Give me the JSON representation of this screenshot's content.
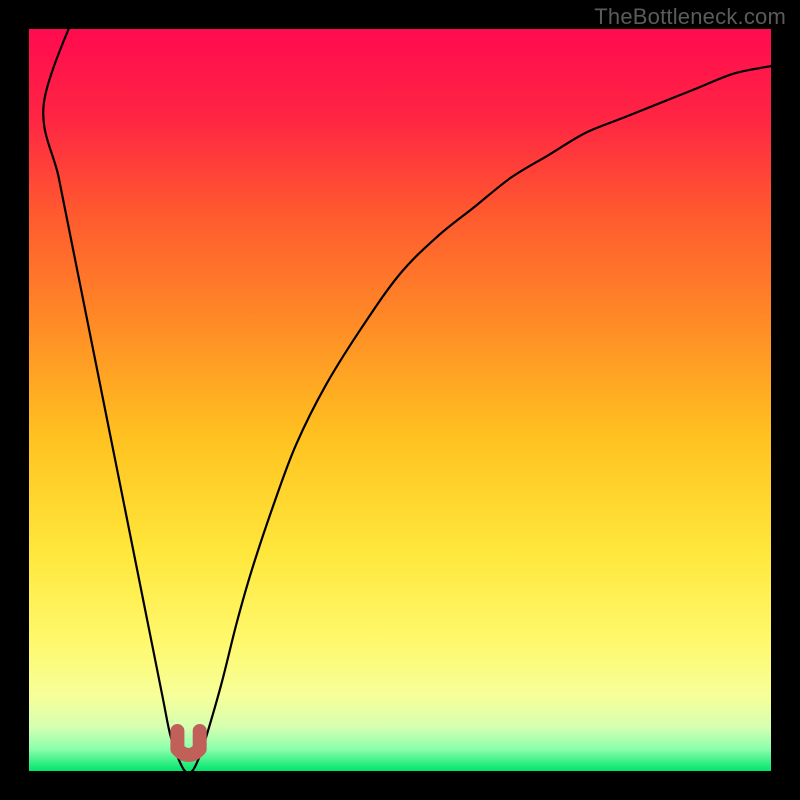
{
  "watermark": "TheBottleneck.com",
  "colors": {
    "gradient_stops": [
      {
        "offset": 0.0,
        "hex": "#ff0b4f"
      },
      {
        "offset": 0.12,
        "hex": "#ff2543"
      },
      {
        "offset": 0.25,
        "hex": "#ff5a2f"
      },
      {
        "offset": 0.4,
        "hex": "#ff8c26"
      },
      {
        "offset": 0.55,
        "hex": "#ffc220"
      },
      {
        "offset": 0.7,
        "hex": "#ffe63a"
      },
      {
        "offset": 0.82,
        "hex": "#fff86a"
      },
      {
        "offset": 0.9,
        "hex": "#f6ff9a"
      },
      {
        "offset": 0.94,
        "hex": "#d6ffb0"
      },
      {
        "offset": 0.97,
        "hex": "#8cffad"
      },
      {
        "offset": 1.0,
        "hex": "#00e66b"
      }
    ],
    "curve": "#000000",
    "dip": "#c06058",
    "border": "#000000"
  },
  "chart_data": {
    "type": "line",
    "title": "",
    "xlabel": "",
    "ylabel": "",
    "xlim": [
      0,
      100
    ],
    "ylim": [
      0,
      100
    ],
    "x": [
      0,
      2,
      4,
      6,
      8,
      10,
      12,
      14,
      16,
      18,
      19,
      20,
      21,
      22,
      23,
      24,
      26,
      28,
      30,
      33,
      36,
      40,
      45,
      50,
      55,
      60,
      65,
      70,
      75,
      80,
      85,
      90,
      95,
      100
    ],
    "series": [
      {
        "name": "bottleneck-curve",
        "values": [
          100,
          90,
          80,
          70,
          60,
          50,
          40,
          30,
          20,
          10,
          5,
          2,
          0,
          0,
          2,
          5,
          12,
          20,
          27,
          36,
          44,
          52,
          60,
          67,
          72,
          76,
          80,
          83,
          86,
          88,
          90,
          92,
          94,
          95
        ]
      }
    ],
    "annotations": [
      {
        "name": "sweet-spot",
        "x_range": [
          20,
          23
        ],
        "y": 0
      }
    ]
  }
}
